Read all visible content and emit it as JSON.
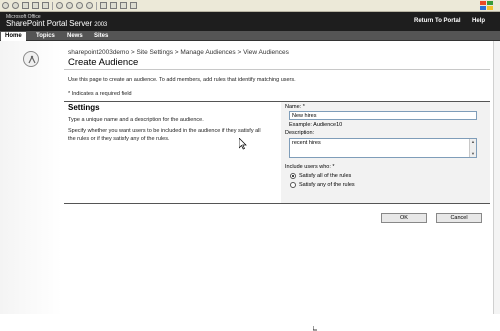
{
  "portal": {
    "brand_small": "Microsoft Office",
    "brand_name": "SharePoint Portal Server",
    "brand_year": "2003",
    "return_link": "Return To Portal",
    "help_link": "Help"
  },
  "nav": {
    "tabs": [
      {
        "label": "Home"
      },
      {
        "label": "Topics"
      },
      {
        "label": "News"
      },
      {
        "label": "Sites"
      }
    ]
  },
  "page": {
    "breadcrumb": "sharepoint2003demo > Site Settings > Manage Audiences > View Audiences",
    "title": "Create Audience",
    "intro": "Use this page to create an audience. To add members, add rules that identify matching users.",
    "required_note": "* Indicates a required field"
  },
  "settings": {
    "title": "Settings",
    "desc1": "Type a unique name and a description for the audience.",
    "desc2": "Specify whether you want users to be included in the audience if they satisfy all the rules or if they satisfy any of the rules.",
    "name_label": "Name: *",
    "name_value": "New hires",
    "example": "Example: Audience10",
    "description_label": "Description:",
    "description_value": "recent hires",
    "include_label": "Include users who: *",
    "options": [
      {
        "label": "Satisfy all of the rules",
        "selected": true
      },
      {
        "label": "Satisfy any of the rules",
        "selected": false
      }
    ]
  },
  "buttons": {
    "ok": "OK",
    "cancel": "Cancel"
  },
  "colors": {
    "header": "#1e1e1e",
    "navbar": "#555555",
    "settings_panel": "#f2f2f2"
  }
}
